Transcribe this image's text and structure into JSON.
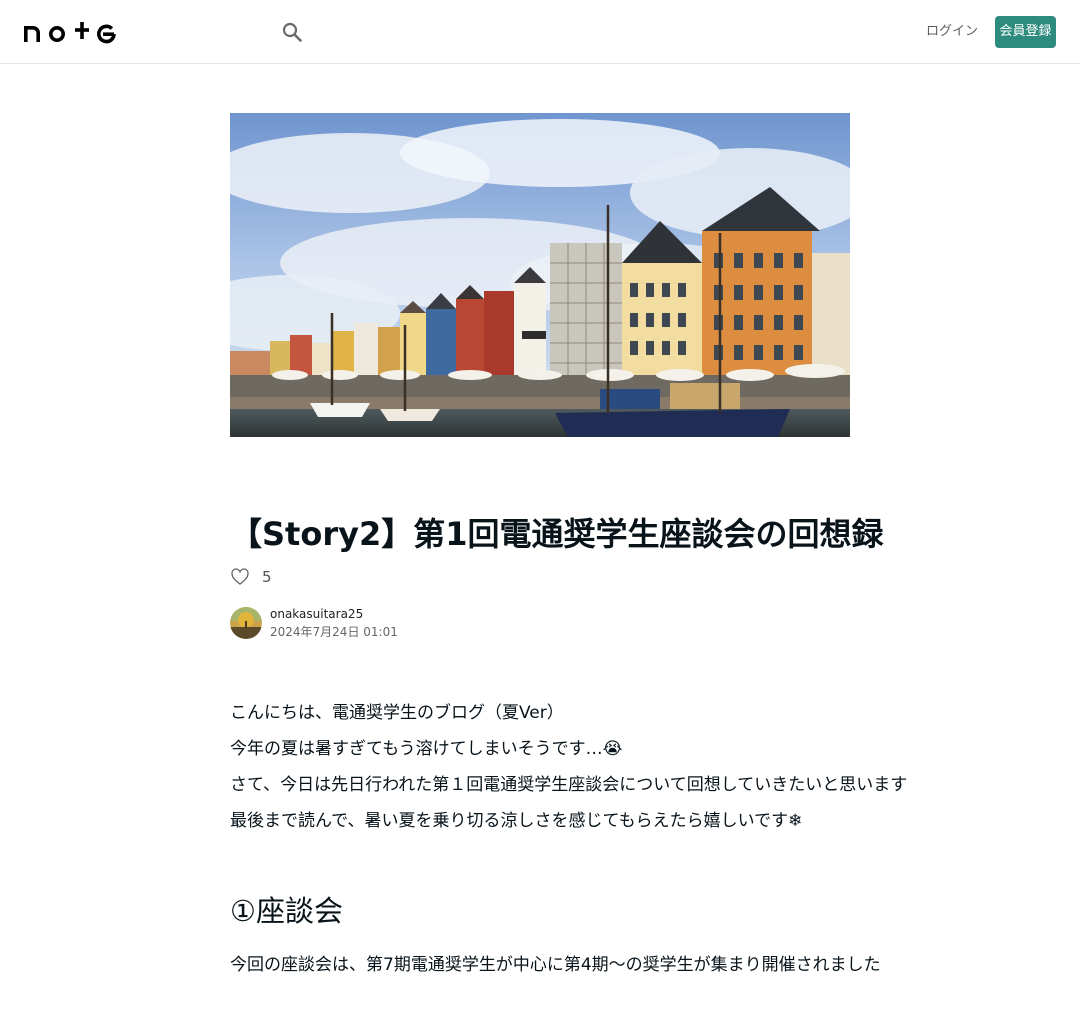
{
  "header": {
    "logo_text": "note",
    "search_icon": "search-icon",
    "login_label": "ログイン",
    "signup_label": "会員登録",
    "accent_color": "#2d8c7e"
  },
  "hero_image": {
    "description_icon": "harbor-photo",
    "sky_color": "#8fb1de"
  },
  "article": {
    "title": "【Story2】第1回電通奨学生座談会の回想録",
    "like_icon": "heart-outline-icon",
    "like_count": "5",
    "author_name": "onakasuitara25",
    "post_date": "2024年7月24日 01:01",
    "paragraphs": [
      "こんにちは、電通奨学生のブログ（夏Ver）",
      "今年の夏は暑すぎてもう溶けてしまいそうです…😭",
      "さて、今日は先日行われた第１回電通奨学生座談会について回想していきたいと思います",
      "最後まで読んで、暑い夏を乗り切る涼しさを感じてもらえたら嬉しいです❄"
    ],
    "section_heading": "①座談会",
    "section_paragraph": "今回の座談会は、第7期電通奨学生が中心に第4期〜の奨学生が集まり開催されました"
  }
}
